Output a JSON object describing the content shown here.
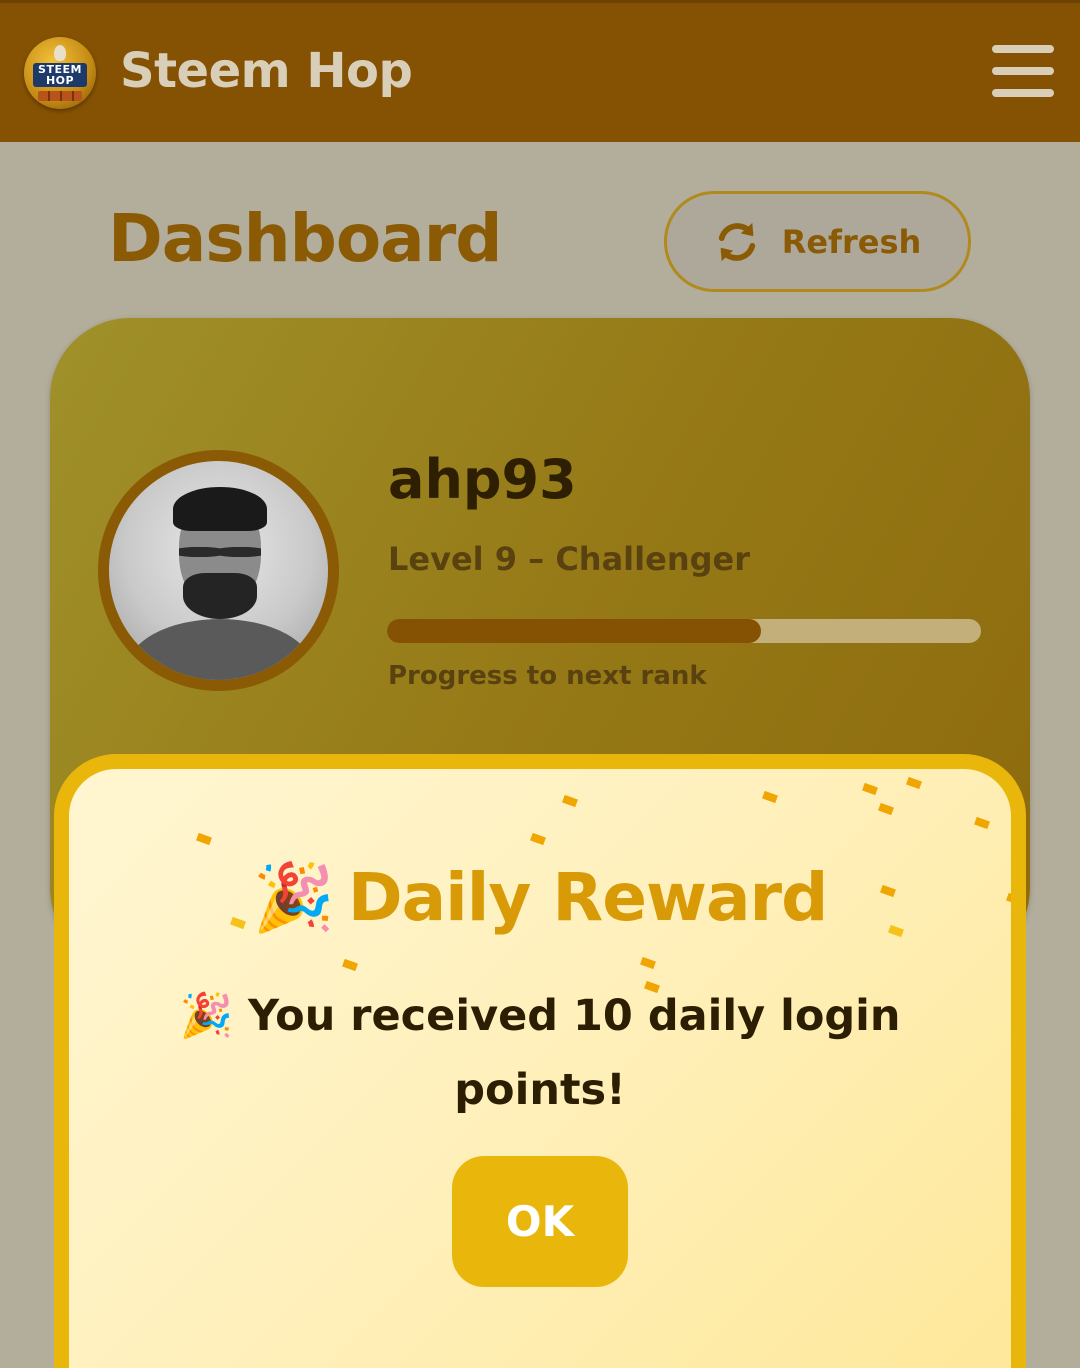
{
  "header": {
    "logo_text": "STEEM HOP",
    "app_name": "Steem Hop",
    "menu_icon": "hamburger-menu-icon"
  },
  "dashboard": {
    "title": "Dashboard",
    "refresh_label": "Refresh",
    "refresh_icon": "refresh-icon"
  },
  "profile": {
    "username": "ahp93",
    "level_text": "Level 9 – Challenger",
    "progress_fraction": 0.63,
    "progress_label": "Progress to next rank"
  },
  "daily_reward_modal": {
    "title_emoji": "🎉",
    "title": "Daily Reward",
    "message": "🎉 You received 10 daily login points!",
    "ok_label": "OK"
  },
  "colors": {
    "header_bg": "#855203",
    "accent_gold": "#e9b70c",
    "title_brown": "#8a5a05",
    "modal_title": "#d99a08"
  }
}
